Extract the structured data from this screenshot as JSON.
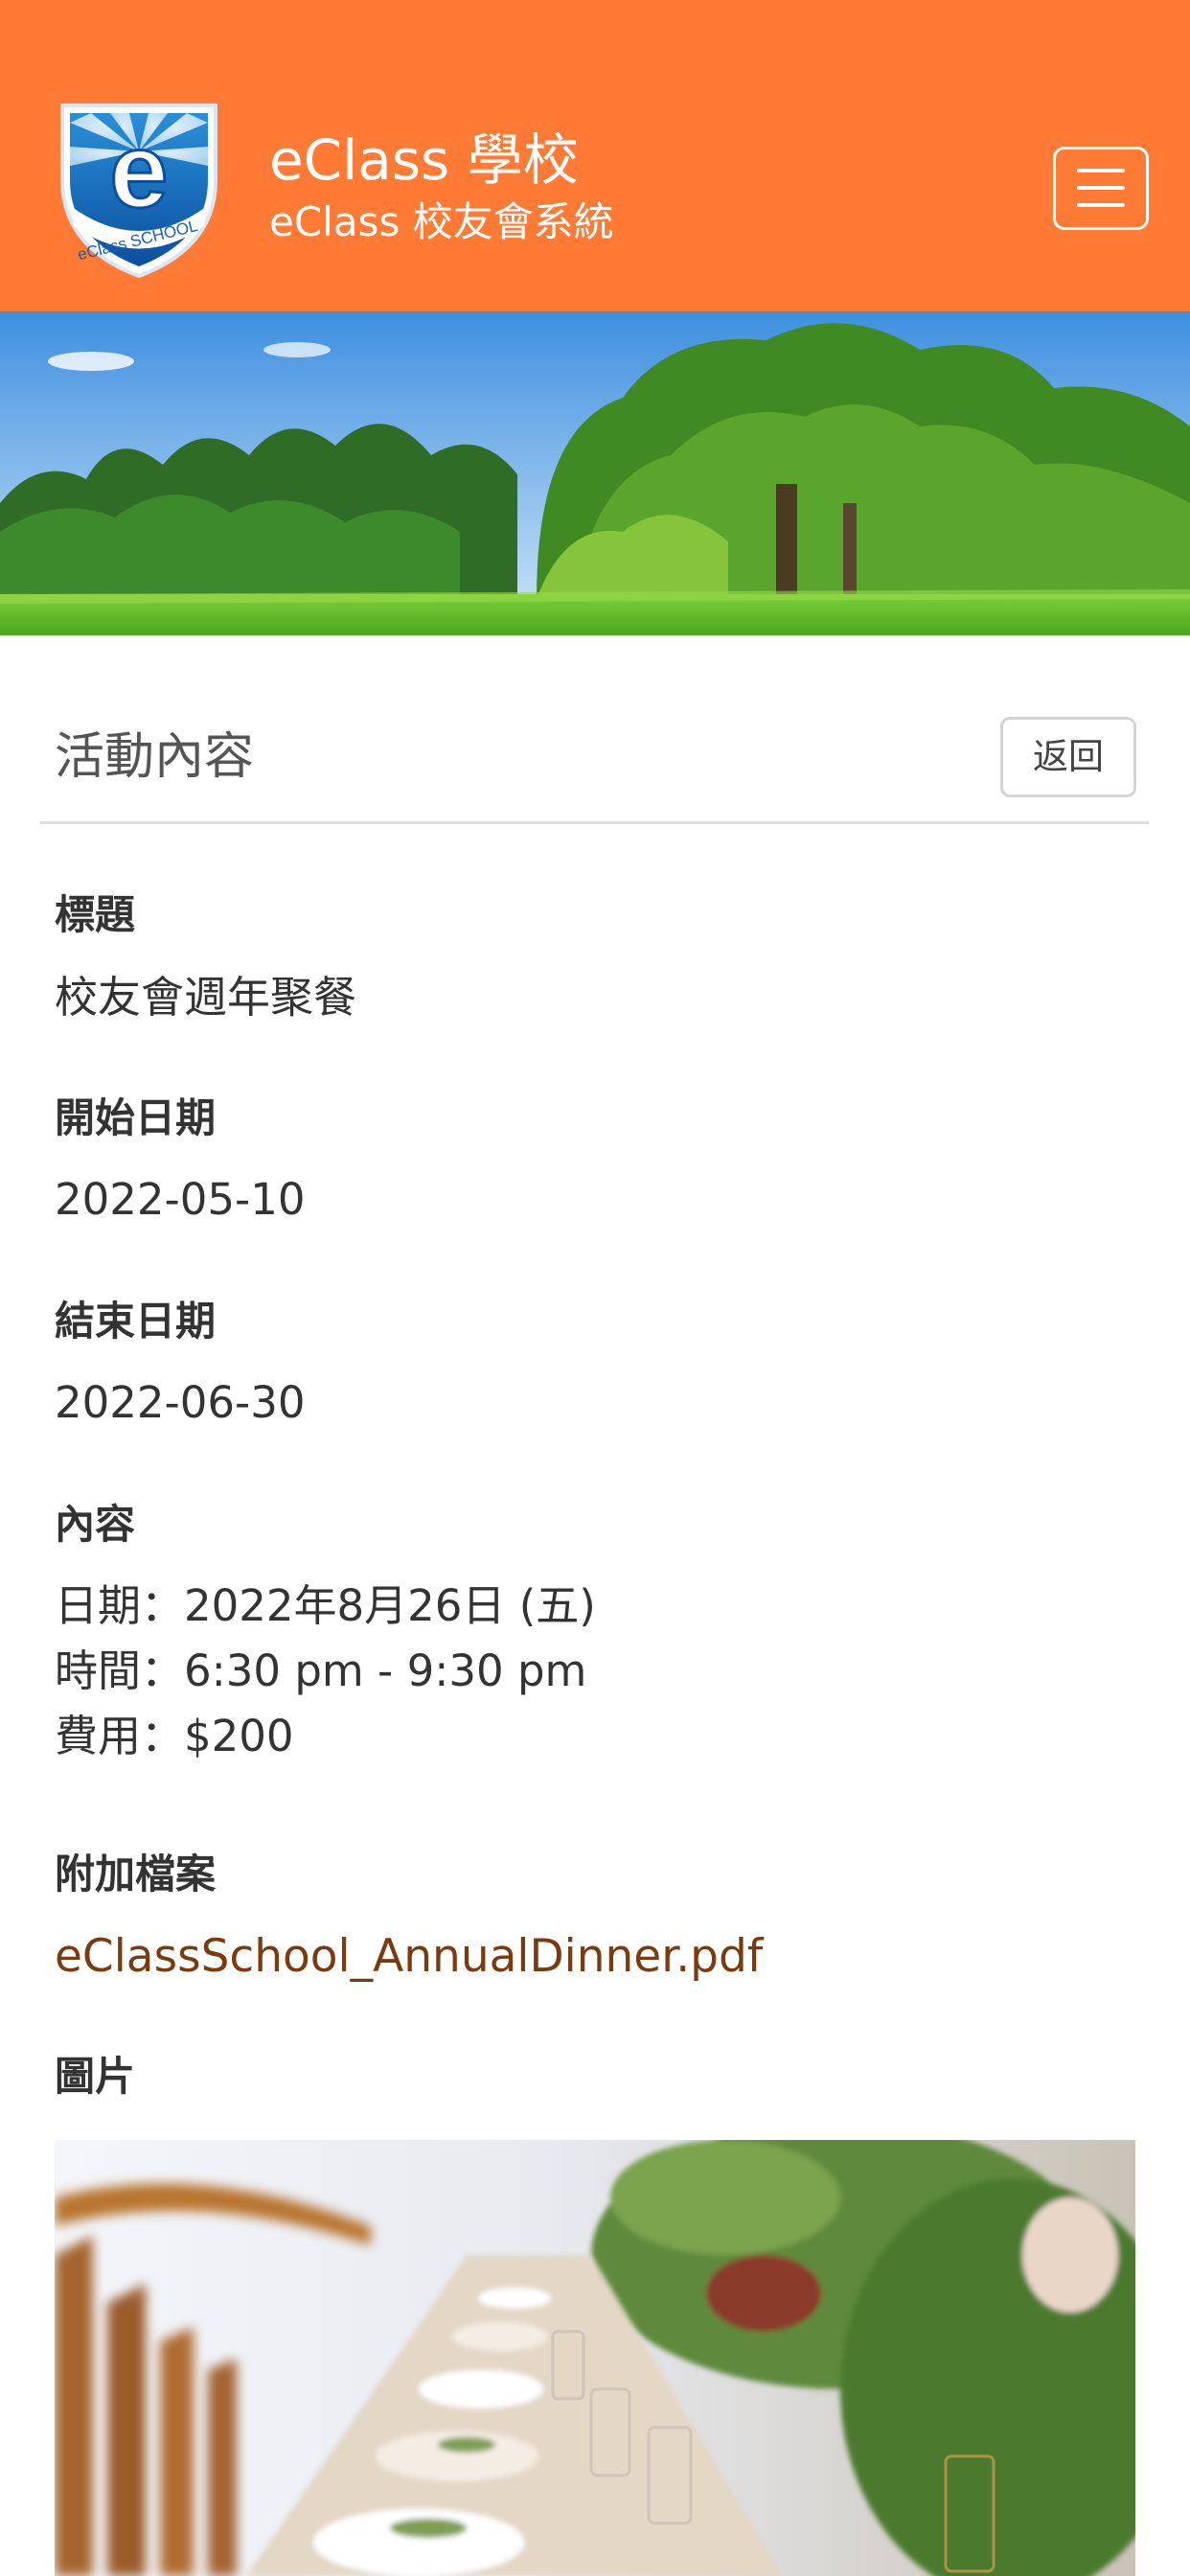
{
  "header": {
    "title": "eClass 學校",
    "subtitle": "eClass 校友會系統",
    "logo_icon": "eclass-school-shield-logo",
    "menu_icon": "hamburger-menu-icon",
    "background_color": "#ff7a35"
  },
  "banner": {
    "image": "park-trees-banner"
  },
  "page": {
    "section_title": "活動內容",
    "back_label": "返回"
  },
  "fields": {
    "title_label": "標題",
    "title_value": "校友會週年聚餐",
    "start_label": "開始日期",
    "start_value": "2022-05-10",
    "end_label": "結束日期",
    "end_value": "2022-06-30",
    "content_label": "內容",
    "content_lines": [
      "日期：2022年8月26日 (五)",
      "時間：6:30 pm - 9:30 pm",
      "費用：$200"
    ],
    "attachment_label": "附加檔案",
    "attachment_file": "eClassSchool_AnnualDinner.pdf",
    "attachment_color": "#7a3b0e",
    "photo_label": "圖片",
    "photo_image": "dinner-table-photo"
  }
}
